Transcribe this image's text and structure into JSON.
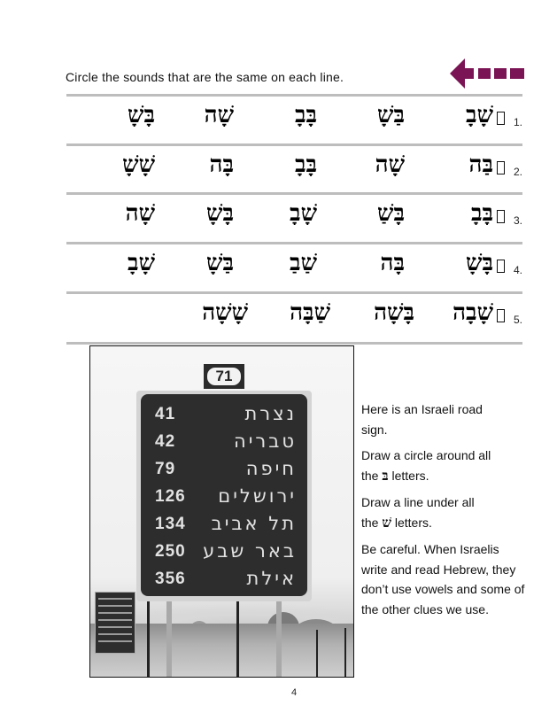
{
  "instruction": "Circle the sounds that are the same on each line.",
  "nav": {
    "arrow_icon": "left-arrow-icon",
    "arrow_color": "#7b1454"
  },
  "exercise": {
    "rows": [
      {
        "number": "1.",
        "target": "שָׁבָ",
        "options": [
          "בַּשָׁ",
          "בָּבָ",
          "שָׁה",
          "בָּשָׁ"
        ]
      },
      {
        "number": "2.",
        "target": "בַּה",
        "options": [
          "שָׁה",
          "בָּבָ",
          "בָּה",
          "שָׁשָׁ"
        ]
      },
      {
        "number": "3.",
        "target": "בָּבָ",
        "options": [
          "בָּשַׁ",
          "שָׁבָ",
          "בָּשָׁ",
          "שָׁה"
        ]
      },
      {
        "number": "4.",
        "target": "בָּשָׁ",
        "options": [
          "בָּה",
          "שַׁבַ",
          "בַּשָׁ",
          "שָׁבָ"
        ]
      },
      {
        "number": "5.",
        "target": "שָׁבָה",
        "options": [
          "בָּשָׁה",
          "שַׁבָּה",
          "שָׁשָׁה"
        ]
      }
    ]
  },
  "photo": {
    "route_number": "71",
    "destinations": [
      {
        "city": "נצרת",
        "distance": "41"
      },
      {
        "city": "טבריה",
        "distance": "42"
      },
      {
        "city": "חיפה",
        "distance": "79"
      },
      {
        "city": "ירושלים",
        "distance": "126"
      },
      {
        "city": "תל אביב",
        "distance": "134"
      },
      {
        "city": "באר שבע",
        "distance": "250"
      },
      {
        "city": "אילת",
        "distance": "356"
      }
    ]
  },
  "side_text": {
    "p1": "Here is an Israeli road sign.",
    "p2_before": "Draw a circle around all the ",
    "p2_letter": "בּ",
    "p2_after": " letters.",
    "p3_before": "Draw a line under all the ",
    "p3_letter": "שׁ",
    "p3_after": " letters.",
    "p4": "Be careful. When Israelis write and read Hebrew, they don’t use vowels and some of the other clues we use."
  },
  "page_number": "4"
}
